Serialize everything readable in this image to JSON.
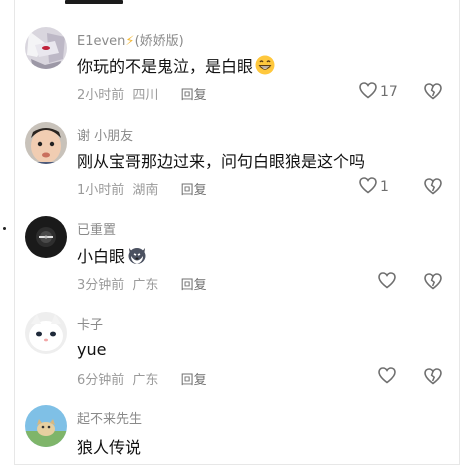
{
  "comments": [
    {
      "username": "E1even",
      "badge": "⚡",
      "username_suffix": "(娇娇版)",
      "text": "你玩的不是鬼泣，是白眼",
      "emoji": "grinning-face-emoji",
      "time": "2小时前",
      "location": "四川",
      "reply": "回复",
      "likes": "17"
    },
    {
      "username": "谢 小朋友",
      "text": "刚从宝哥那边过来，问句白眼狼是这个吗",
      "time": "1小时前",
      "location": "湖南",
      "reply": "回复",
      "likes": "1"
    },
    {
      "username": "已重置",
      "text": "小白眼",
      "emoji": "husky-dog-emoji",
      "time": "3分钟前",
      "location": "广东",
      "reply": "回复",
      "likes": ""
    },
    {
      "username": "卡子",
      "text": "yue",
      "time": "6分钟前",
      "location": "广东",
      "reply": "回复",
      "likes": ""
    },
    {
      "username": "起不来先生",
      "text": "狼人传说"
    }
  ],
  "colors": {
    "username": "#8a8a8a",
    "text": "#111111",
    "meta": "#9a9a9a",
    "badge": "#f2b93b"
  }
}
